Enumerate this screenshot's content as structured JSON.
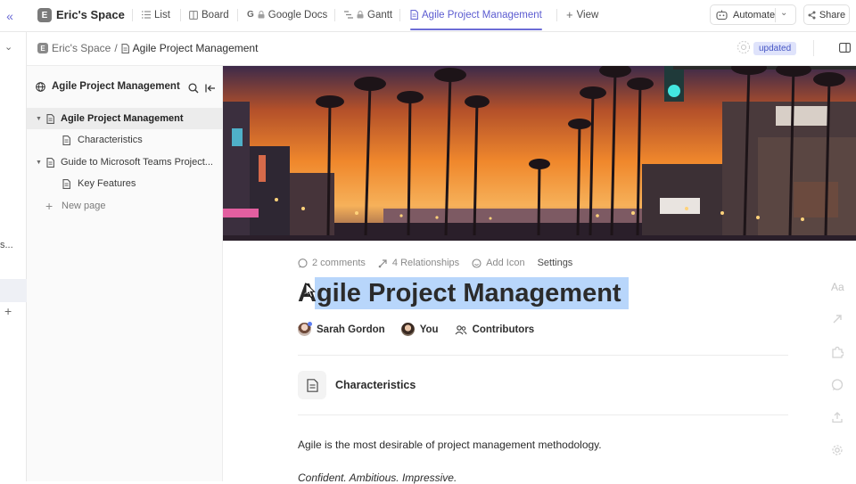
{
  "topbar": {
    "space_initial": "E",
    "space_name": "Eric's Space",
    "tabs": [
      {
        "label": "List",
        "icon": "list-icon"
      },
      {
        "label": "Board",
        "icon": "board-icon"
      },
      {
        "label": "Google Docs",
        "icon": "google-lock-icon"
      },
      {
        "label": "Gantt",
        "icon": "gantt-lock-icon"
      },
      {
        "label": "Agile Project Management",
        "icon": "doc-icon",
        "active": true
      }
    ],
    "add_view_label": "View",
    "automate_label": "Automate",
    "share_label": "Share"
  },
  "breadcrumb": {
    "space": "Eric's Space",
    "separator": "/",
    "page": "Agile Project Management",
    "status_badge": "updated"
  },
  "rail": {
    "truncated_text": "s..."
  },
  "sidebar": {
    "title": "Agile Project Management",
    "items": [
      {
        "label": "Agile Project Management",
        "level": 0,
        "expanded": true,
        "active": true
      },
      {
        "label": "Characteristics",
        "level": 1
      },
      {
        "label": "Guide to Microsoft Teams Project...",
        "level": 0,
        "expanded": true
      },
      {
        "label": "Key Features",
        "level": 1
      }
    ],
    "new_page_label": "New page"
  },
  "document": {
    "meta": {
      "comments": "2 comments",
      "relationships": "4 Relationships",
      "add_icon": "Add Icon",
      "settings": "Settings"
    },
    "title": "Agile Project Management",
    "authors": [
      {
        "name": "Sarah Gordon"
      },
      {
        "name": "You"
      },
      {
        "name": "Contributors"
      }
    ],
    "subpage": "Characteristics",
    "paragraph": "Agile is the most desirable of project management methodology.",
    "tagline": "Confident. Ambitious. Impressive."
  },
  "right_tools": {
    "font_label": "Aa"
  },
  "colors": {
    "accent": "#6c6cd6",
    "badge_bg": "#dfe3fb",
    "badge_text": "#4656c4",
    "selection": "#b8d6fb"
  }
}
